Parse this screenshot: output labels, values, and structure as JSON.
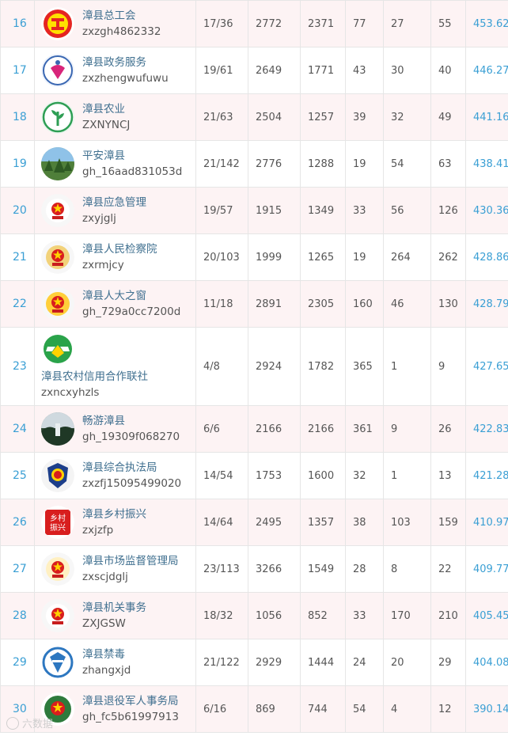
{
  "rows": [
    {
      "rank": "16",
      "name": "漳县总工会",
      "id": "zxzgh4862332",
      "ratio": "17/36",
      "total": "2772",
      "max": "2371",
      "c1": "77",
      "c2": "27",
      "c3": "55",
      "score": "453.62",
      "icon": "trade-union-logo-icon",
      "style": "odd"
    },
    {
      "rank": "17",
      "name": "漳县政务服务",
      "id": "zxzhengwufuwu",
      "ratio": "19/61",
      "total": "2649",
      "max": "1771",
      "c1": "43",
      "c2": "30",
      "c3": "40",
      "score": "446.27",
      "icon": "government-service-logo-icon",
      "style": "even"
    },
    {
      "rank": "18",
      "name": "漳县农业",
      "id": "ZXNYNCJ",
      "ratio": "21/63",
      "total": "2504",
      "max": "1257",
      "c1": "39",
      "c2": "32",
      "c3": "49",
      "score": "441.16",
      "icon": "agriculture-logo-icon",
      "style": "odd"
    },
    {
      "rank": "19",
      "name": "平安漳县",
      "id": "gh_16aad831053d",
      "ratio": "21/142",
      "total": "2776",
      "max": "1288",
      "c1": "19",
      "c2": "54",
      "c3": "63",
      "score": "438.41",
      "icon": "landscape-photo-icon",
      "style": "even"
    },
    {
      "rank": "20",
      "name": "漳县应急管理",
      "id": "zxyjglj",
      "ratio": "19/57",
      "total": "1915",
      "max": "1349",
      "c1": "33",
      "c2": "56",
      "c3": "126",
      "score": "430.36",
      "icon": "emergency-emblem-icon",
      "style": "odd"
    },
    {
      "rank": "21",
      "name": "漳县人民检察院",
      "id": "zxrmjcy",
      "ratio": "20/103",
      "total": "1999",
      "max": "1265",
      "c1": "19",
      "c2": "264",
      "c3": "262",
      "score": "428.86",
      "icon": "procuratorate-emblem-icon",
      "style": "even"
    },
    {
      "rank": "22",
      "name": "漳县人大之窗",
      "id": "gh_729a0cc7200d",
      "ratio": "11/18",
      "total": "2891",
      "max": "2305",
      "c1": "160",
      "c2": "46",
      "c3": "130",
      "score": "428.79",
      "icon": "national-emblem-icon",
      "style": "odd"
    },
    {
      "rank": "23",
      "name": "漳县农村信用合作联社",
      "id": "zxncxyhzls",
      "ratio": "4/8",
      "total": "2924",
      "max": "1782",
      "c1": "365",
      "c2": "1",
      "c3": "9",
      "score": "427.65",
      "icon": "credit-union-logo-icon",
      "style": "even",
      "stack": true
    },
    {
      "rank": "24",
      "name": "畅游漳县",
      "id": "gh_19309f068270",
      "ratio": "6/6",
      "total": "2166",
      "max": "2166",
      "c1": "361",
      "c2": "9",
      "c3": "26",
      "score": "422.83",
      "icon": "scenery-photo-icon",
      "style": "odd"
    },
    {
      "rank": "25",
      "name": "漳县综合执法局",
      "id": "zxzfj15095499020",
      "ratio": "14/54",
      "total": "1753",
      "max": "1600",
      "c1": "32",
      "c2": "1",
      "c3": "13",
      "score": "421.28",
      "icon": "law-enforcement-badge-icon",
      "style": "even"
    },
    {
      "rank": "26",
      "name": "漳县乡村振兴",
      "id": "zxjzfp",
      "ratio": "14/64",
      "total": "2495",
      "max": "1357",
      "c1": "38",
      "c2": "103",
      "c3": "159",
      "score": "410.97",
      "icon": "rural-revitalization-logo-icon",
      "style": "odd",
      "logo_text": "乡村振兴"
    },
    {
      "rank": "27",
      "name": "漳县市场监督管理局",
      "id": "zxscjdglj",
      "ratio": "23/113",
      "total": "3266",
      "max": "1549",
      "c1": "28",
      "c2": "8",
      "c3": "22",
      "score": "409.77",
      "icon": "market-supervision-emblem-icon",
      "style": "even"
    },
    {
      "rank": "28",
      "name": "漳县机关事务",
      "id": "ZXJGSW",
      "ratio": "18/32",
      "total": "1056",
      "max": "852",
      "c1": "33",
      "c2": "170",
      "c3": "210",
      "score": "405.45",
      "icon": "government-affairs-emblem-icon",
      "style": "odd"
    },
    {
      "rank": "29",
      "name": "漳县禁毒",
      "id": "zhangxjd",
      "ratio": "21/122",
      "total": "2929",
      "max": "1444",
      "c1": "24",
      "c2": "20",
      "c3": "29",
      "score": "404.08",
      "icon": "anti-drug-logo-icon",
      "style": "even"
    },
    {
      "rank": "30",
      "name": "漳县退役军人事务局",
      "id": "gh_fc5b61997913",
      "ratio": "6/16",
      "total": "869",
      "max": "744",
      "c1": "54",
      "c2": "4",
      "c3": "12",
      "score": "390.14",
      "icon": "veterans-emblem-icon",
      "style": "odd"
    }
  ],
  "watermark": "六数据"
}
